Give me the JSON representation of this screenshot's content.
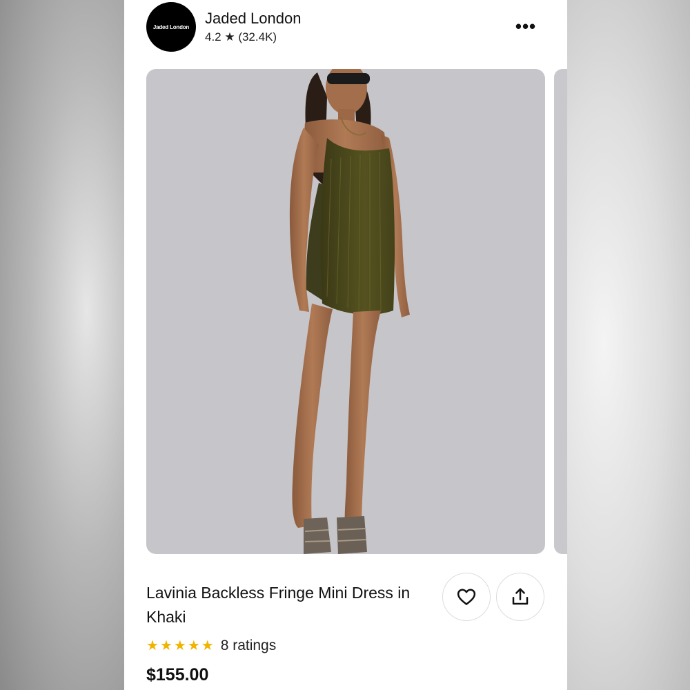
{
  "shop": {
    "logo_text": "Jaded London",
    "name": "Jaded London",
    "rating_text": "4.2 ★ (32.4K)"
  },
  "header": {
    "more_label": "•••"
  },
  "product": {
    "image_alt": "Model wearing khaki fringe mini dress",
    "title": "Lavinia Backless Fringe Mini Dress in Khaki",
    "rating": {
      "stars": 5,
      "count_text": "8 ratings"
    },
    "price": "$155.00"
  },
  "actions": {
    "favorite_icon": "heart-icon",
    "share_icon": "share-icon"
  },
  "colors": {
    "star": "#f0b400",
    "image_bg": "#c6c5c9",
    "dress": "#4d4a1c"
  }
}
